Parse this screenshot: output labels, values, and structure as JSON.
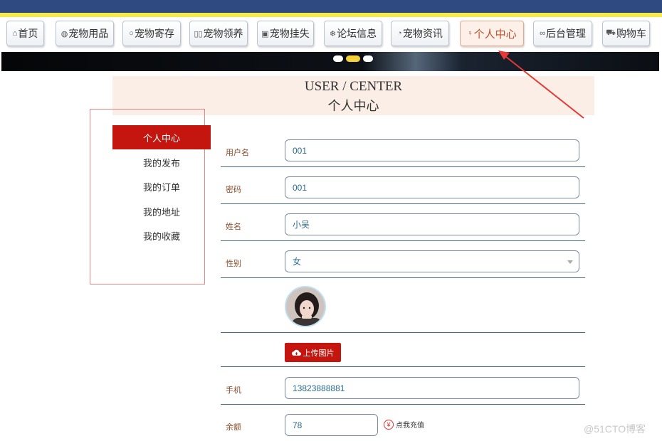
{
  "nav": {
    "items": [
      {
        "label": "首页",
        "icon": "home-icon",
        "glyph": "⌂"
      },
      {
        "label": "宠物用品",
        "icon": "globe-icon",
        "glyph": "◍"
      },
      {
        "label": "宠物寄存",
        "icon": "circle-icon",
        "glyph": "○"
      },
      {
        "label": "宠物领养",
        "icon": "paws-icon",
        "glyph": "▯▯"
      },
      {
        "label": "宠物挂失",
        "icon": "grid-icon",
        "glyph": "▣"
      },
      {
        "label": "论坛信息",
        "icon": "snowflake-icon",
        "glyph": "❄"
      },
      {
        "label": "宠物资讯",
        "icon": "gauge-icon",
        "glyph": "◔"
      },
      {
        "label": "个人中心",
        "icon": "user-icon",
        "glyph": "♀"
      },
      {
        "label": "后台管理",
        "icon": "link-icon",
        "glyph": "🔗"
      },
      {
        "label": "购物车",
        "icon": "cart-icon",
        "glyph": "🛒"
      }
    ],
    "active_index": 7
  },
  "banner": {
    "dots": 3,
    "active_dot": 1
  },
  "header": {
    "title_en": "USER / CENTER",
    "title_cn": "个人中心"
  },
  "sidebar": {
    "items": [
      {
        "label": "个人中心",
        "active": true
      },
      {
        "label": "我的发布",
        "active": false
      },
      {
        "label": "我的订单",
        "active": false
      },
      {
        "label": "我的地址",
        "active": false
      },
      {
        "label": "我的收藏",
        "active": false
      }
    ]
  },
  "form": {
    "username": {
      "label": "用户名",
      "value": "001"
    },
    "password": {
      "label": "密码",
      "value": "001"
    },
    "name": {
      "label": "姓名",
      "value": "小吴"
    },
    "gender": {
      "label": "性别",
      "value": "女"
    },
    "upload": {
      "label": "上传图片"
    },
    "phone": {
      "label": "手机",
      "value": "13823888881"
    },
    "balance": {
      "label": "余额",
      "value": "78",
      "recharge_label": "点我充值"
    }
  },
  "watermark": "@51CTO博客",
  "colors": {
    "accent": "#c4160f",
    "topbar": "#2f4a80",
    "yellow": "#f4ea4b",
    "header_bg": "#fbeee6"
  }
}
